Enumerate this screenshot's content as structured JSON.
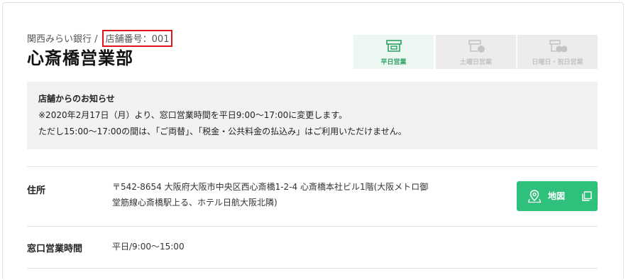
{
  "header": {
    "bank_name": "関西みらい銀行 /",
    "branch_number": "店舗番号：001",
    "branch_name": "心斎橋営業部"
  },
  "hours_tabs": [
    {
      "label": "平日営業",
      "icon": "storefront-icon",
      "active": true
    },
    {
      "label": "土曜日営業",
      "icon": "storefront-saturday-icon",
      "active": false
    },
    {
      "label": "日曜日・祝日営業",
      "icon": "storefront-sunday-holiday-icon",
      "active": false
    }
  ],
  "notice": {
    "title": "店舗からのお知らせ",
    "lines": [
      "※2020年2月17日（月）より、窓口営業時間を平日9:00～17:00に変更します。",
      "ただし15:00～17:00の間は、「ご両替」、「税金・公共料金の払込み」はご利用いただけません。"
    ]
  },
  "info": {
    "address_label": "住所",
    "address_lines": [
      "〒542-8654 大阪府大阪市中央区西心斎橋1-2-4 心斎橋本社ビル1階(大阪メトロ御",
      "堂筋線心斎橋駅上る、ホテル日航大阪北隣)"
    ],
    "map_button": "地図",
    "hours_label": "窓口営業時間",
    "hours_value": "平日/9:00～15:00"
  },
  "colors": {
    "accent_green": "#2fc07c",
    "active_tab_bg": "#edf7f1",
    "highlight_red": "#e0141b"
  }
}
